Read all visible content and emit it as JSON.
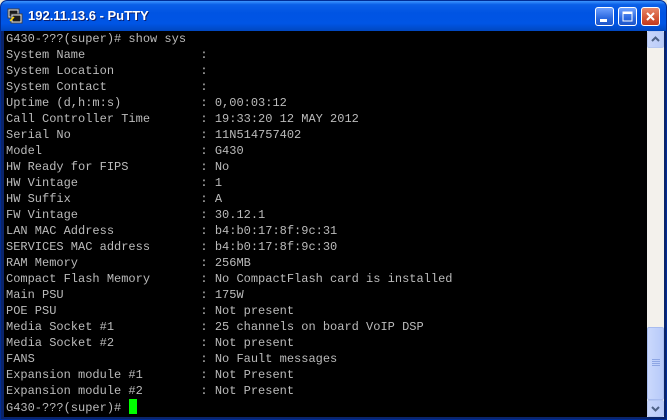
{
  "window": {
    "title": "192.11.13.6 - PuTTY",
    "icons": {
      "app": "putty-terminal-icon",
      "minimize": "minimize-icon",
      "maximize": "maximize-icon",
      "close": "close-icon"
    },
    "colors": {
      "titlebar": "#0054e3",
      "terminal_bg": "#000000",
      "terminal_fg": "#bbbbbb",
      "cursor": "#00ff00"
    }
  },
  "terminal": {
    "lines": [
      "G430-???(super)# show sys",
      "System Name                : ",
      "System Location            : ",
      "System Contact             : ",
      "Uptime (d,h:m:s)           : 0,00:03:12",
      "Call Controller Time       : 19:33:20 12 MAY 2012",
      "Serial No                  : 11N514757402",
      "Model                      : G430",
      "HW Ready for FIPS          : No",
      "HW Vintage                 : 1",
      "HW Suffix                  : A",
      "FW Vintage                 : 30.12.1",
      "LAN MAC Address            : b4:b0:17:8f:9c:31",
      "SERVICES MAC address       : b4:b0:17:8f:9c:30",
      "RAM Memory                 : 256MB",
      "Compact Flash Memory       : No CompactFlash card is installed",
      "Main PSU                   : 175W",
      "POE PSU                    : Not present",
      "Media Socket #1            : 25 channels on board VoIP DSP",
      "Media Socket #2            : Not present",
      "FANS                       : No Fault messages",
      "Expansion module #1        : Not Present",
      "Expansion module #2        : Not Present"
    ],
    "prompt": "G430-???(super)# "
  },
  "scrollbar": {
    "icons": {
      "up": "scroll-up-arrow-icon",
      "down": "scroll-down-arrow-icon"
    },
    "position_fraction": 1.0
  }
}
